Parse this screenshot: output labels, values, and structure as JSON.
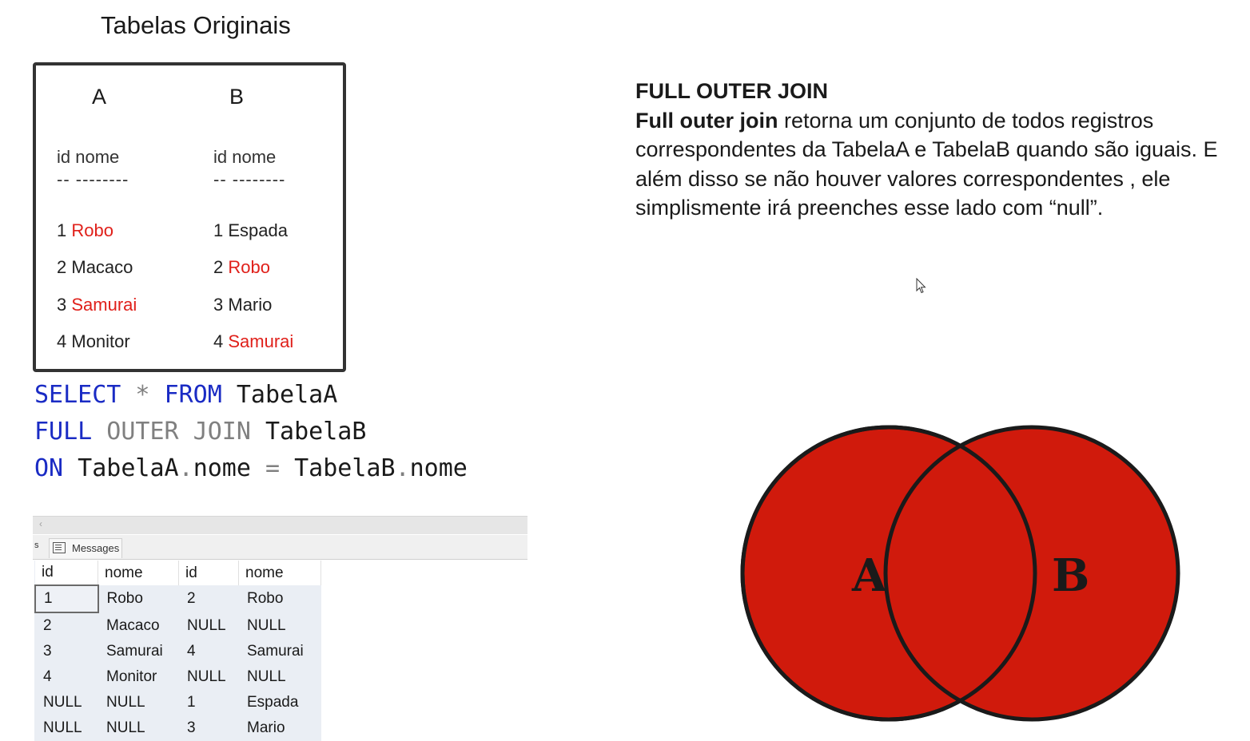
{
  "original_tables": {
    "title": "Tabelas Originais",
    "table_a": {
      "label": "A",
      "header": "id nome",
      "separator": "-- --------",
      "rows": [
        {
          "id": "1",
          "nome": "Robo",
          "match": true
        },
        {
          "id": "2",
          "nome": "Macaco",
          "match": false
        },
        {
          "id": "3",
          "nome": "Samurai",
          "match": true
        },
        {
          "id": "4",
          "nome": "Monitor",
          "match": false
        }
      ]
    },
    "table_b": {
      "label": "B",
      "header": "id nome",
      "separator": "-- --------",
      "rows": [
        {
          "id": "1",
          "nome": "Espada",
          "match": false
        },
        {
          "id": "2",
          "nome": "Robo",
          "match": true
        },
        {
          "id": "3",
          "nome": "Mario",
          "match": false
        },
        {
          "id": "4",
          "nome": "Samurai",
          "match": true
        }
      ]
    }
  },
  "sql": {
    "line1": {
      "kw1": "SELECT",
      "star": " * ",
      "kw2": "FROM",
      "rest": " TabelaA"
    },
    "line2": {
      "kw1": "FULL",
      "gray": " OUTER JOIN",
      "rest": " TabelaB"
    },
    "line3": {
      "kw1": "ON",
      "a1": " TabelaA",
      "dot1": ".",
      "a2": "nome ",
      "eq": "=",
      "b1": " TabelaB",
      "dot2": ".",
      "b2": "nome"
    }
  },
  "results": {
    "scroll_arrow": "‹",
    "left_tab": "s",
    "messages_tab": "Messages",
    "columns": [
      "id",
      "nome",
      "id",
      "nome"
    ],
    "rows": [
      [
        "1",
        "Robo",
        "2",
        "Robo"
      ],
      [
        "2",
        "Macaco",
        "NULL",
        "NULL"
      ],
      [
        "3",
        "Samurai",
        "4",
        "Samurai"
      ],
      [
        "4",
        "Monitor",
        "NULL",
        "NULL"
      ],
      [
        "NULL",
        "NULL",
        "1",
        "Espada"
      ],
      [
        "NULL",
        "NULL",
        "3",
        "Mario"
      ]
    ]
  },
  "description": {
    "heading": "FULL OUTER JOIN",
    "bold_lead": "Full outer join",
    "text": " retorna um conjunto de todos registros correspondentes da TabelaA e TabelaB quando são iguais. E além disso se não houver valores correspondentes , ele simplismente irá preenches esse lado com “null”."
  },
  "venn": {
    "label_a": "A",
    "label_b": "B",
    "fill_color": "#d01a0c"
  },
  "colors": {
    "keyword": "#1a2bc4",
    "highlight": "#e0201a"
  }
}
